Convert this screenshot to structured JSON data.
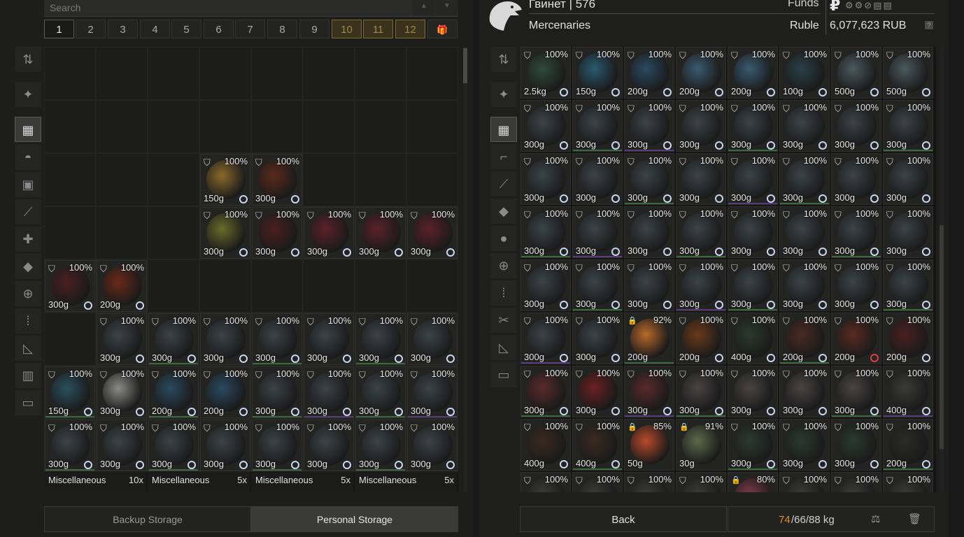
{
  "search": {
    "placeholder": "Search"
  },
  "stash_tabs": [
    "1",
    "2",
    "3",
    "4",
    "5",
    "6",
    "7",
    "8",
    "9",
    "10",
    "11",
    "12"
  ],
  "left_sidebar": [
    "sort-icon",
    "star-icon",
    "grid-icon",
    "helmet-icon",
    "backpack-icon",
    "weapon-mod-icon",
    "medical-icon",
    "grenade-icon",
    "first-aid-icon",
    "ammo-icon",
    "ruler-icon",
    "container-icon",
    "box-icon"
  ],
  "left_items": [
    {
      "c": 3,
      "r": 2,
      "pct": "100%",
      "wt": "150g",
      "art": "#8a6a2a"
    },
    {
      "c": 4,
      "r": 2,
      "pct": "100%",
      "wt": "300g",
      "art": "#5a2a1a"
    },
    {
      "c": 3,
      "r": 3,
      "pct": "100%",
      "wt": "300g",
      "art": "#6a6a2a"
    },
    {
      "c": 4,
      "r": 3,
      "pct": "100%",
      "wt": "300g",
      "art": "#4a2020"
    },
    {
      "c": 5,
      "r": 3,
      "pct": "100%",
      "wt": "300g",
      "art": "#5a2228"
    },
    {
      "c": 6,
      "r": 3,
      "pct": "100%",
      "wt": "300g",
      "art": "#5a2228"
    },
    {
      "c": 7,
      "r": 3,
      "pct": "100%",
      "wt": "300g",
      "art": "#5a2228"
    },
    {
      "c": 0,
      "r": 4,
      "pct": "100%",
      "wt": "300g",
      "art": "#4a2020"
    },
    {
      "c": 1,
      "r": 4,
      "pct": "100%",
      "wt": "200g",
      "art": "#6a2a18"
    },
    {
      "c": 1,
      "r": 5,
      "pct": "100%",
      "wt": "300g",
      "art": "#3a4448"
    },
    {
      "c": 2,
      "r": 5,
      "pct": "100%",
      "wt": "300g",
      "art": "#3a4448"
    },
    {
      "c": 3,
      "r": 5,
      "pct": "100%",
      "wt": "300g",
      "art": "#3a4448"
    },
    {
      "c": 4,
      "r": 5,
      "pct": "100%",
      "wt": "300g",
      "art": "#3a4448"
    },
    {
      "c": 5,
      "r": 5,
      "pct": "100%",
      "wt": "300g",
      "art": "#3a4448"
    },
    {
      "c": 6,
      "r": 5,
      "pct": "100%",
      "wt": "300g",
      "art": "#3a4448"
    },
    {
      "c": 7,
      "r": 5,
      "pct": "100%",
      "wt": "300g",
      "art": "#3a4448"
    },
    {
      "c": 0,
      "r": 6,
      "pct": "100%",
      "wt": "150g",
      "art": "#2a5060"
    },
    {
      "c": 1,
      "r": 6,
      "pct": "100%",
      "wt": "300g",
      "art": "#8a8a88"
    },
    {
      "c": 2,
      "r": 6,
      "pct": "100%",
      "wt": "200g",
      "art": "#2a4a60"
    },
    {
      "c": 3,
      "r": 6,
      "pct": "100%",
      "wt": "200g",
      "art": "#2a4a60"
    },
    {
      "c": 4,
      "r": 6,
      "pct": "100%",
      "wt": "300g",
      "art": "#3a4448"
    },
    {
      "c": 5,
      "r": 6,
      "pct": "100%",
      "wt": "300g",
      "art": "#3a4448"
    },
    {
      "c": 6,
      "r": 6,
      "pct": "100%",
      "wt": "300g",
      "art": "#3a4448"
    },
    {
      "c": 7,
      "r": 6,
      "pct": "100%",
      "wt": "300g",
      "art": "#3a4448"
    },
    {
      "c": 0,
      "r": 7,
      "pct": "100%",
      "wt": "300g",
      "art": "#3a4448"
    },
    {
      "c": 1,
      "r": 7,
      "pct": "100%",
      "wt": "300g",
      "art": "#3a4448"
    },
    {
      "c": 2,
      "r": 7,
      "pct": "100%",
      "wt": "300g",
      "art": "#3a4448"
    },
    {
      "c": 3,
      "r": 7,
      "pct": "100%",
      "wt": "300g",
      "art": "#3a4448"
    },
    {
      "c": 4,
      "r": 7,
      "pct": "100%",
      "wt": "300g",
      "art": "#3a4448"
    },
    {
      "c": 5,
      "r": 7,
      "pct": "100%",
      "wt": "300g",
      "art": "#3a4448"
    },
    {
      "c": 6,
      "r": 7,
      "pct": "100%",
      "wt": "300g",
      "art": "#3a4448"
    },
    {
      "c": 7,
      "r": 7,
      "pct": "100%",
      "wt": "300g",
      "art": "#3a4448"
    }
  ],
  "misc_rows": [
    {
      "label": "Miscellaneous",
      "count": "10x"
    },
    {
      "label": "Miscellaneous",
      "count": "5x"
    },
    {
      "label": "Miscellaneous",
      "count": "5x"
    },
    {
      "label": "Miscellaneous",
      "count": "5x"
    }
  ],
  "storage_tabs": [
    "Backup Storage",
    "Personal Storage"
  ],
  "trader": {
    "name_line": "Гвинет | 576",
    "funds_label": "Funds",
    "faction": "Mercenaries",
    "currency": "Ruble",
    "balance": "6,077,623 RUB",
    "currency_symbol": "₽"
  },
  "right_sidebar": [
    "sort-icon",
    "star-icon",
    "grid-icon",
    "rifle-icon",
    "weapon-mod-icon",
    "grenade-icon",
    "sphere-icon",
    "first-aid-icon",
    "ammo-icon",
    "tools-icon",
    "ruler-icon",
    "box-icon"
  ],
  "right_items": [
    [
      "100%",
      "2.5kg"
    ],
    [
      "100%",
      "150g"
    ],
    [
      "100%",
      "200g"
    ],
    [
      "100%",
      "200g"
    ],
    [
      "100%",
      "200g"
    ],
    [
      "100%",
      "100g"
    ],
    [
      "100%",
      "500g"
    ],
    [
      "100%",
      "500g"
    ],
    [
      "100%",
      "300g"
    ],
    [
      "100%",
      "300g"
    ],
    [
      "100%",
      "300g"
    ],
    [
      "100%",
      "300g"
    ],
    [
      "100%",
      "300g"
    ],
    [
      "100%",
      "300g"
    ],
    [
      "100%",
      "300g"
    ],
    [
      "100%",
      "300g"
    ],
    [
      "100%",
      "300g"
    ],
    [
      "100%",
      "300g"
    ],
    [
      "100%",
      "300g"
    ],
    [
      "100%",
      "300g"
    ],
    [
      "100%",
      "300g"
    ],
    [
      "100%",
      "300g"
    ],
    [
      "100%",
      "300g"
    ],
    [
      "100%",
      "300g"
    ],
    [
      "100%",
      "300g"
    ],
    [
      "100%",
      "300g"
    ],
    [
      "100%",
      "300g"
    ],
    [
      "100%",
      "300g"
    ],
    [
      "100%",
      "300g"
    ],
    [
      "100%",
      "300g"
    ],
    [
      "100%",
      "300g"
    ],
    [
      "100%",
      "300g"
    ],
    [
      "100%",
      "300g"
    ],
    [
      "100%",
      "300g"
    ],
    [
      "100%",
      "300g"
    ],
    [
      "100%",
      "300g"
    ],
    [
      "100%",
      "300g"
    ],
    [
      "100%",
      "300g"
    ],
    [
      "100%",
      "300g"
    ],
    [
      "100%",
      "300g"
    ],
    [
      "100%",
      "300g"
    ],
    [
      "100%",
      "300g"
    ],
    [
      "92%",
      "200g"
    ],
    [
      "100%",
      "200g"
    ],
    [
      "100%",
      "400g"
    ],
    [
      "100%",
      "200g"
    ],
    [
      "100%",
      "200g"
    ],
    [
      "100%",
      "200g"
    ],
    [
      "100%",
      "300g"
    ],
    [
      "100%",
      "300g"
    ],
    [
      "100%",
      "300g"
    ],
    [
      "100%",
      "300g"
    ],
    [
      "100%",
      "300g"
    ],
    [
      "100%",
      "300g"
    ],
    [
      "100%",
      "300g"
    ],
    [
      "100%",
      "400g"
    ],
    [
      "100%",
      "400g"
    ],
    [
      "100%",
      "400g"
    ],
    [
      "85%",
      "50g"
    ],
    [
      "91%",
      "30g"
    ],
    [
      "100%",
      "300g"
    ],
    [
      "100%",
      "300g"
    ],
    [
      "100%",
      "300g"
    ],
    [
      "100%",
      "200g"
    ],
    [
      "100%",
      ""
    ],
    [
      "100%",
      ""
    ],
    [
      "100%",
      ""
    ],
    [
      "100%",
      ""
    ],
    [
      "80%",
      ""
    ],
    [
      "100%",
      ""
    ],
    [
      "100%",
      ""
    ],
    [
      "100%",
      ""
    ]
  ],
  "right_art_colors": [
    "#2f4a3a",
    "#2a5a70",
    "#2a4a60",
    "#3a5a70",
    "#3a5a70",
    "#2a4048",
    "#4a5a60",
    "#4a5a60",
    "#3a4448",
    "#3a4448",
    "#3a4448",
    "#3a4448",
    "#3a4448",
    "#3a4448",
    "#3a4448",
    "#3a4448",
    "#3a4448",
    "#3a4448",
    "#3a4448",
    "#3a4448",
    "#3a4448",
    "#3a4448",
    "#3a4448",
    "#3a4448",
    "#3a4448",
    "#3a4448",
    "#3a4448",
    "#3a4448",
    "#3a4448",
    "#3a4448",
    "#3a4448",
    "#3a4448",
    "#3a4448",
    "#3a4448",
    "#3a4448",
    "#3a4448",
    "#3a4448",
    "#3a4448",
    "#3a4448",
    "#3a4448",
    "#3a4448",
    "#3a4448",
    "#b86a2a",
    "#6a3a1a",
    "#2a3a2a",
    "#4a2a22",
    "#5a2a20",
    "#4a2020",
    "#5a2a2a",
    "#6a2020",
    "#5a2a2a",
    "#4a4444",
    "#4a4444",
    "#4a4444",
    "#4a4444",
    "#3a3a38",
    "#3a2a20",
    "#3a2a20",
    "#b84a2a",
    "#5a6a4a",
    "#2a3a30",
    "#2a3a30",
    "#2a3a30",
    "#2a2a28",
    "#3a3a38",
    "#3a3a38",
    "#3a3a38",
    "#3a3a38",
    "#7a3a4a",
    "#3a3a38",
    "#3a3a38",
    "#3a3a38"
  ],
  "right_red_clock_index": 46,
  "right_locked": [
    42,
    58,
    59,
    68
  ],
  "bottom": {
    "back_label": "Back",
    "weight_current": "74",
    "weight_rest": "/66/88 kg"
  },
  "colors": {
    "accent_gold": "#a08a4a",
    "weight_current": "#e08a2a",
    "green_line": "#3a6a3a",
    "purple_line": "#5a3a7a"
  }
}
